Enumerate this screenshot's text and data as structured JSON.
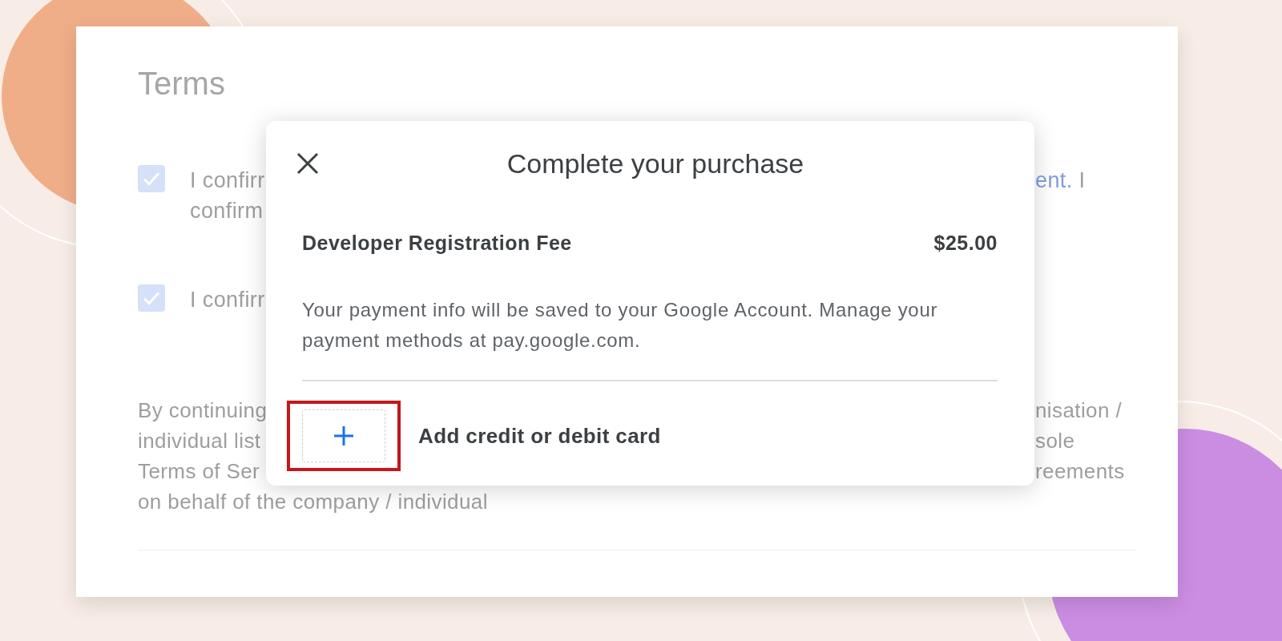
{
  "page": {
    "title": "Terms",
    "checkbox_rows": [
      {
        "checked": true,
        "left_lines": [
          "I confirr",
          "confirm"
        ],
        "right": [
          {
            "kind": "link",
            "text": "ent."
          },
          {
            "kind": "text",
            "text": "I"
          }
        ]
      },
      {
        "checked": true,
        "left_lines": [
          "I confirr"
        ]
      }
    ],
    "paragraph": [
      {
        "left": "By continuing",
        "right": "nisation /"
      },
      {
        "left": "individual list",
        "right": "sole"
      },
      {
        "left": "Terms of Ser",
        "right": "reements"
      },
      {
        "left": "on behalf of the company / individual"
      }
    ]
  },
  "dialog": {
    "title": "Complete your purchase",
    "item": {
      "name": "Developer Registration Fee",
      "price": "$25.00"
    },
    "info": "Your payment info will be saved to your Google Account. Manage your payment methods at pay.google.com.",
    "add_card": {
      "label": "Add credit or debit card",
      "highlighted": true
    }
  }
}
